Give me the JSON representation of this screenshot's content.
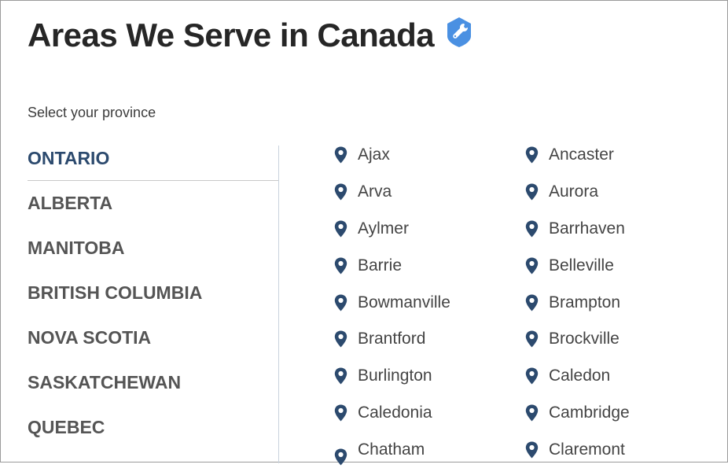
{
  "page": {
    "title": "Areas We Serve in Canada",
    "badge_icon": "service-badge-icon",
    "subtitle": "Select your province"
  },
  "colors": {
    "active_province": "#2c4a6e",
    "province": "#555555",
    "pin": "#2c4a6e",
    "badge": "#4a90e2",
    "title": "#262626"
  },
  "provinces": [
    {
      "label": "ONTARIO",
      "active": true
    },
    {
      "label": "ALBERTA",
      "active": false
    },
    {
      "label": "MANITOBA",
      "active": false
    },
    {
      "label": "BRITISH COLUMBIA",
      "active": false
    },
    {
      "label": "NOVA SCOTIA",
      "active": false
    },
    {
      "label": "SASKATCHEWAN",
      "active": false
    },
    {
      "label": "QUEBEC",
      "active": false
    }
  ],
  "cities": [
    "Ajax",
    "Ancaster",
    "Arva",
    "Aurora",
    "Aylmer",
    "Barrhaven",
    "Barrie",
    "Belleville",
    "Bowmanville",
    "Brampton",
    "Brantford",
    "Brockville",
    "Burlington",
    "Caledon",
    "Caledonia",
    "Cambridge",
    "Chatham",
    "Claremont"
  ]
}
